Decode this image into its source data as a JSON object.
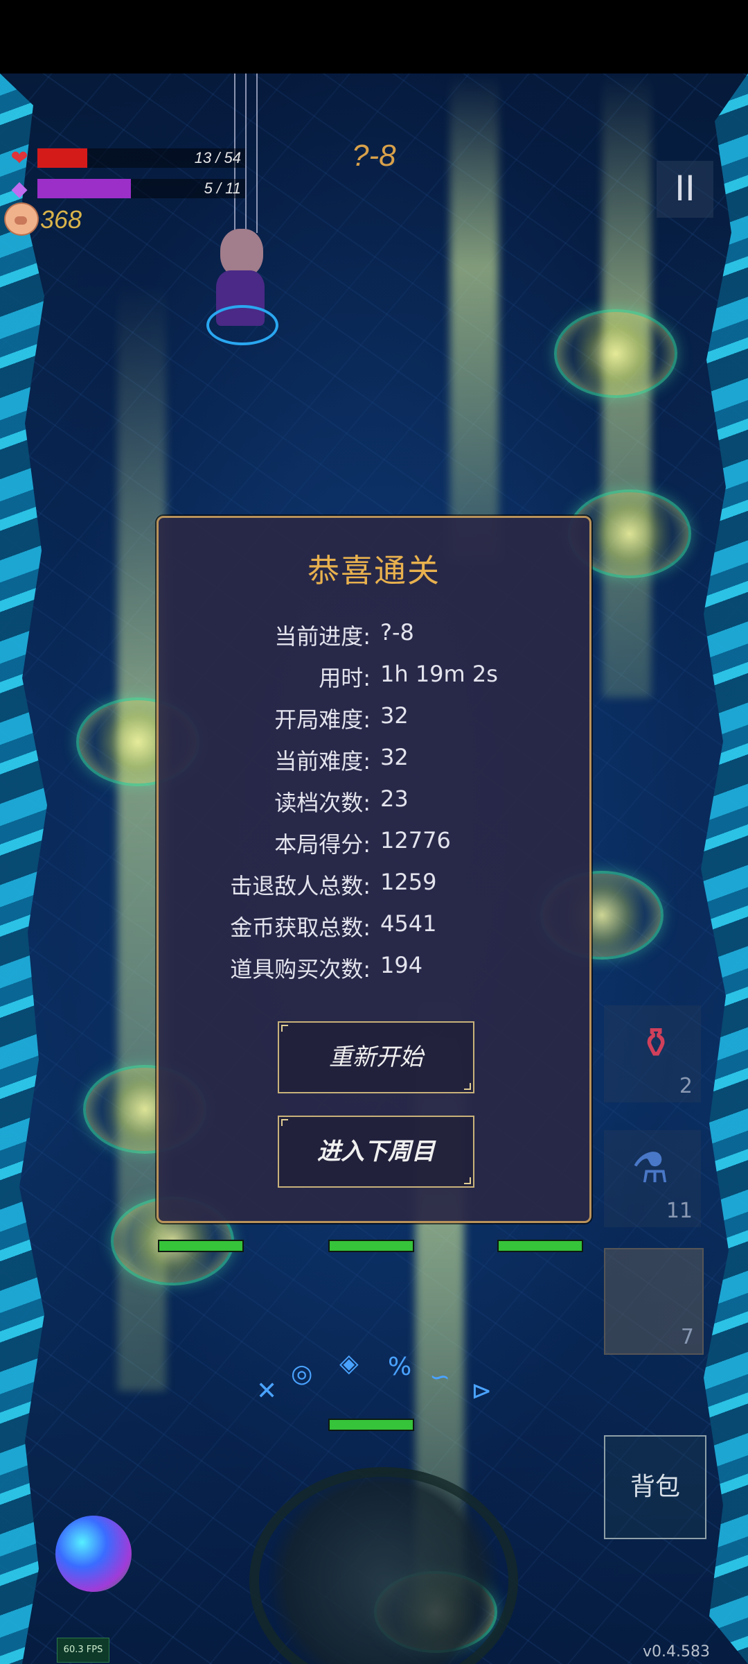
{
  "hud": {
    "hp_text": "13 / 54",
    "hp_fraction": 0.24,
    "hp_color": "#d51a1a",
    "mp_text": "5 / 11",
    "mp_fraction": 0.45,
    "mp_color": "#9b2fc8",
    "coins": "368",
    "level": "?-8",
    "pause_glyph": "II",
    "heart_glyph": "❤",
    "gem_glyph": "◆"
  },
  "dialog": {
    "title": "恭喜通关",
    "stats": [
      {
        "label": "当前进度:",
        "value": "?-8"
      },
      {
        "label": "用时:",
        "value": "1h 19m 2s"
      },
      {
        "label": "开局难度:",
        "value": "32"
      },
      {
        "label": "当前难度:",
        "value": "32"
      },
      {
        "label": "读档次数:",
        "value": "23"
      },
      {
        "label": "本局得分:",
        "value": "12776"
      },
      {
        "label": "击退敌人总数:",
        "value": "1259"
      },
      {
        "label": "金币获取总数:",
        "value": "4541"
      },
      {
        "label": "道具购买次数:",
        "value": "194"
      }
    ],
    "restart_label": "重新开始",
    "next_cycle_label": "进入下周目"
  },
  "items": {
    "potion_count": "2",
    "flask_count": "11",
    "slot3_count": "7"
  },
  "bag_label": "背包",
  "fps": "60.3 FPS",
  "version": "v0.4.583",
  "enemy_health_fraction": 1.0,
  "colors": {
    "accent_gold": "#e8b14e",
    "dialog_border": "#b9925a",
    "enemy_hp": "#36c43a"
  }
}
